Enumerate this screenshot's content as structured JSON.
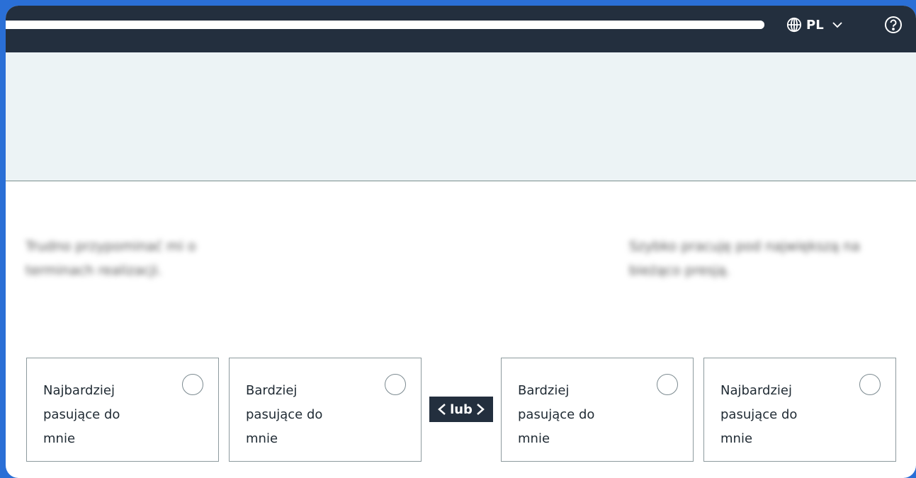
{
  "topbar": {
    "progress": 1.0,
    "language": {
      "code": "PL",
      "icon": "globe-icon",
      "chevron": "chevron-down-icon"
    },
    "help_icon": "help-circle-icon",
    "color": "#232f3e"
  },
  "statements": {
    "left": "Trudno przypominać mi o terminach realizacji.",
    "right": "Szybko pracuję pod największą na bieżąco presją."
  },
  "separator": {
    "label": "lub"
  },
  "options": [
    {
      "label": "Najbardziej pasujące do mnie",
      "selected": false
    },
    {
      "label": "Bardziej pasujące do mnie",
      "selected": false
    },
    {
      "label": "Bardziej pasujące do mnie",
      "selected": false
    },
    {
      "label": "Najbardziej pasujące do mnie",
      "selected": false
    }
  ]
}
